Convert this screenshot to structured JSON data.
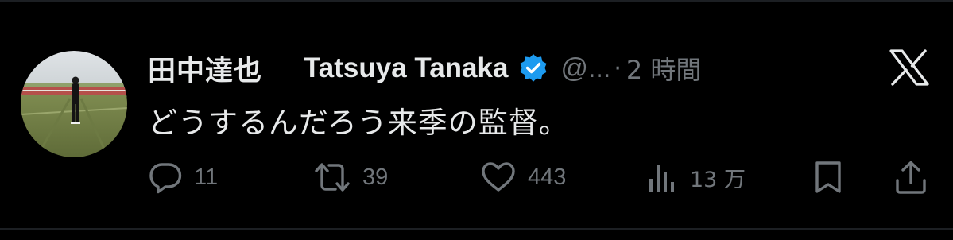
{
  "post": {
    "display_name_ja": "田中達也",
    "display_name_en": "Tatsuya Tanaka",
    "handle": "@...",
    "separator": "·",
    "time": "2 時間",
    "text": "どうするんだろう来季の監督。",
    "verified_badge_icon": "verified-badge-icon",
    "verified_color": "#1d9bf0"
  },
  "actions": {
    "reply_count": "11",
    "repost_count": "39",
    "like_count": "443",
    "views_count": "13 万"
  },
  "icons": {
    "reply": "reply-icon",
    "repost": "repost-icon",
    "like": "heart-icon",
    "views": "views-icon",
    "bookmark": "bookmark-icon",
    "share": "share-icon",
    "brand": "x-logo-icon"
  },
  "colors": {
    "background": "#000000",
    "text_primary": "#e7e9ea",
    "text_secondary": "#71767b",
    "divider": "#1c1f23"
  }
}
